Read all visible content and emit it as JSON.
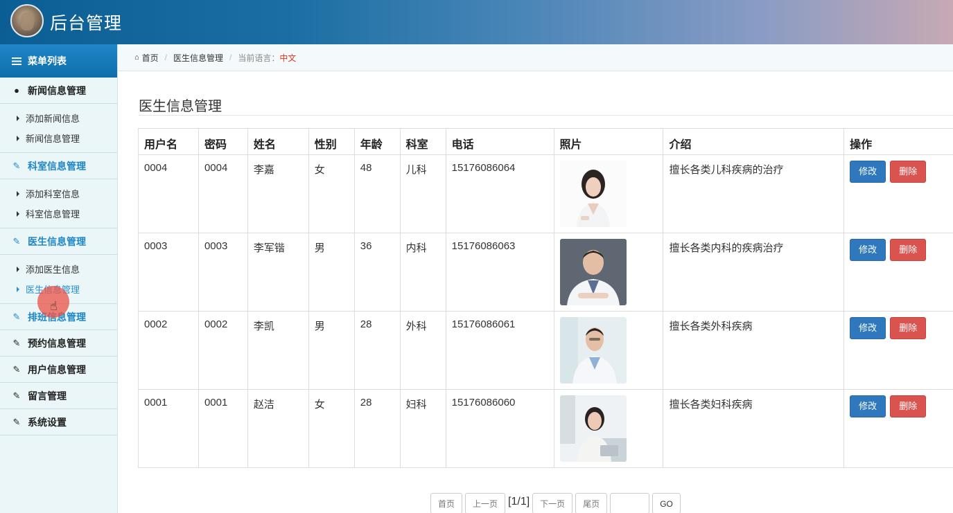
{
  "app": {
    "title": "后台管理"
  },
  "sidebar": {
    "menu_title": "菜单列表",
    "groups": [
      {
        "label": "新闻信息管理",
        "icon": "user-icon",
        "items": [
          "添加新闻信息",
          "新闻信息管理"
        ]
      },
      {
        "label": "科室信息管理",
        "icon": "edit-icon",
        "items": [
          "添加科室信息",
          "科室信息管理"
        ]
      },
      {
        "label": "医生信息管理",
        "icon": "edit-icon",
        "items": [
          "添加医生信息",
          "医生信息管理"
        ]
      },
      {
        "label": "排班信息管理",
        "icon": "edit-icon"
      },
      {
        "label": "预约信息管理",
        "icon": "edit-icon"
      },
      {
        "label": "用户信息管理",
        "icon": "edit-icon"
      },
      {
        "label": "留言管理",
        "icon": "edit-icon"
      },
      {
        "label": "系统设置",
        "icon": "edit-icon"
      }
    ]
  },
  "breadcrumb": {
    "home": "首页",
    "current": "医生信息管理",
    "lang_label": "当前语言：",
    "lang_value": "中文"
  },
  "main": {
    "title": "医生信息管理",
    "columns": [
      "用户名",
      "密码",
      "姓名",
      "性别",
      "年龄",
      "科室",
      "电话",
      "照片",
      "介绍",
      "操作"
    ],
    "rows": [
      {
        "username": "0004",
        "password": "0004",
        "name": "李嘉",
        "gender": "女",
        "age": "48",
        "dept": "儿科",
        "phone": "15176086064",
        "intro": "擅长各类儿科疾病的治疗"
      },
      {
        "username": "0003",
        "password": "0003",
        "name": "李军锴",
        "gender": "男",
        "age": "36",
        "dept": "内科",
        "phone": "15176086063",
        "intro": "擅长各类内科的疾病治疗"
      },
      {
        "username": "0002",
        "password": "0002",
        "name": "李凯",
        "gender": "男",
        "age": "28",
        "dept": "外科",
        "phone": "15176086061",
        "intro": "擅长各类外科疾病"
      },
      {
        "username": "0001",
        "password": "0001",
        "name": "赵洁",
        "gender": "女",
        "age": "28",
        "dept": "妇科",
        "phone": "15176086060",
        "intro": "擅长各类妇科疾病"
      }
    ],
    "edit_label": "修改",
    "delete_label": "删除"
  },
  "pager": {
    "first": "首页",
    "prev": "上一页",
    "info": "[1/1]",
    "next": "下一页",
    "last": "尾页",
    "go": "GO"
  },
  "colors": {
    "header_start": "#0b5e94",
    "sidebar_bg": "#eaf6f8",
    "accent": "#1f87c5",
    "edit_btn": "#2f78bd",
    "delete_btn": "#d9534f",
    "lang_value": "#d9361e"
  }
}
